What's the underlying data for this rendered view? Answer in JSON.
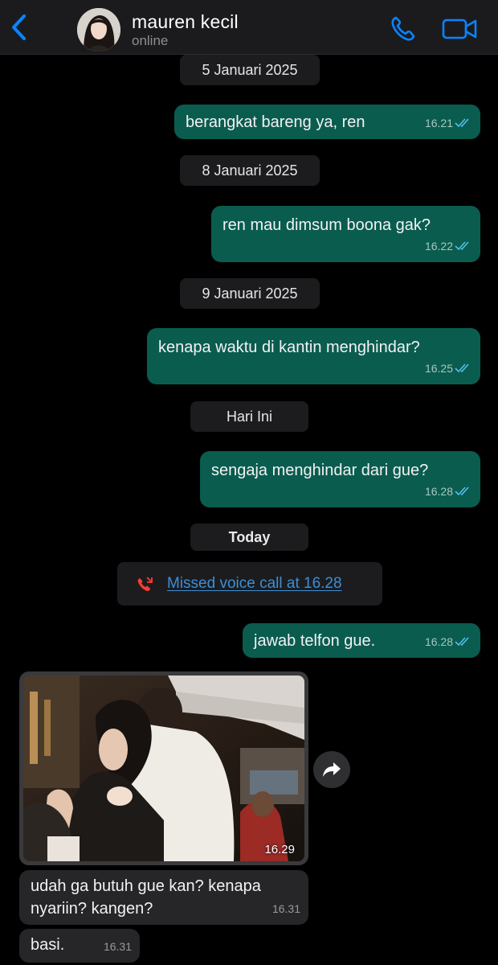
{
  "header": {
    "contact_name": "mauren kecil",
    "status": "online",
    "back_icon": "chevron-left-icon",
    "call_icon": "phone-icon",
    "video_icon": "video-camera-icon",
    "accent_color": "#0a84ff"
  },
  "messages": [
    {
      "kind": "date",
      "text": "5 Januari 2025"
    },
    {
      "kind": "outgoing",
      "text": "berangkat bareng ya, ren",
      "time": "16.21",
      "status": "read"
    },
    {
      "kind": "date",
      "text": "8 Januari 2025"
    },
    {
      "kind": "outgoing",
      "text": "ren mau dimsum boona gak?",
      "time": "16.22",
      "status": "read"
    },
    {
      "kind": "date",
      "text": "9 Januari 2025"
    },
    {
      "kind": "outgoing",
      "text": "kenapa waktu di kantin menghindar?",
      "time": "16.25",
      "status": "read"
    },
    {
      "kind": "date",
      "text": "Hari Ini"
    },
    {
      "kind": "outgoing",
      "text": "sengaja menghindar dari gue?",
      "time": "16.28",
      "status": "read"
    },
    {
      "kind": "date",
      "text": "Today"
    },
    {
      "kind": "missed_call",
      "text": "Missed voice call at 16.28",
      "icon": "missed-call-icon"
    },
    {
      "kind": "outgoing",
      "text": "jawab telfon gue.",
      "time": "16.28",
      "status": "read"
    },
    {
      "kind": "incoming_photo",
      "time": "16.29",
      "share_icon": "forward-share-icon"
    },
    {
      "kind": "incoming",
      "text": "udah ga butuh gue kan? kenapa nyariin? kangen?",
      "time": "16.31"
    },
    {
      "kind": "incoming",
      "text": "basi.",
      "time": "16.31"
    }
  ],
  "colors": {
    "outgoing_bubble": "#0a5c4f",
    "incoming_bubble": "#262628",
    "read_ticks": "#53bdeb",
    "missed_call_red": "#ff3b30",
    "link_blue": "#3b8fd8"
  }
}
